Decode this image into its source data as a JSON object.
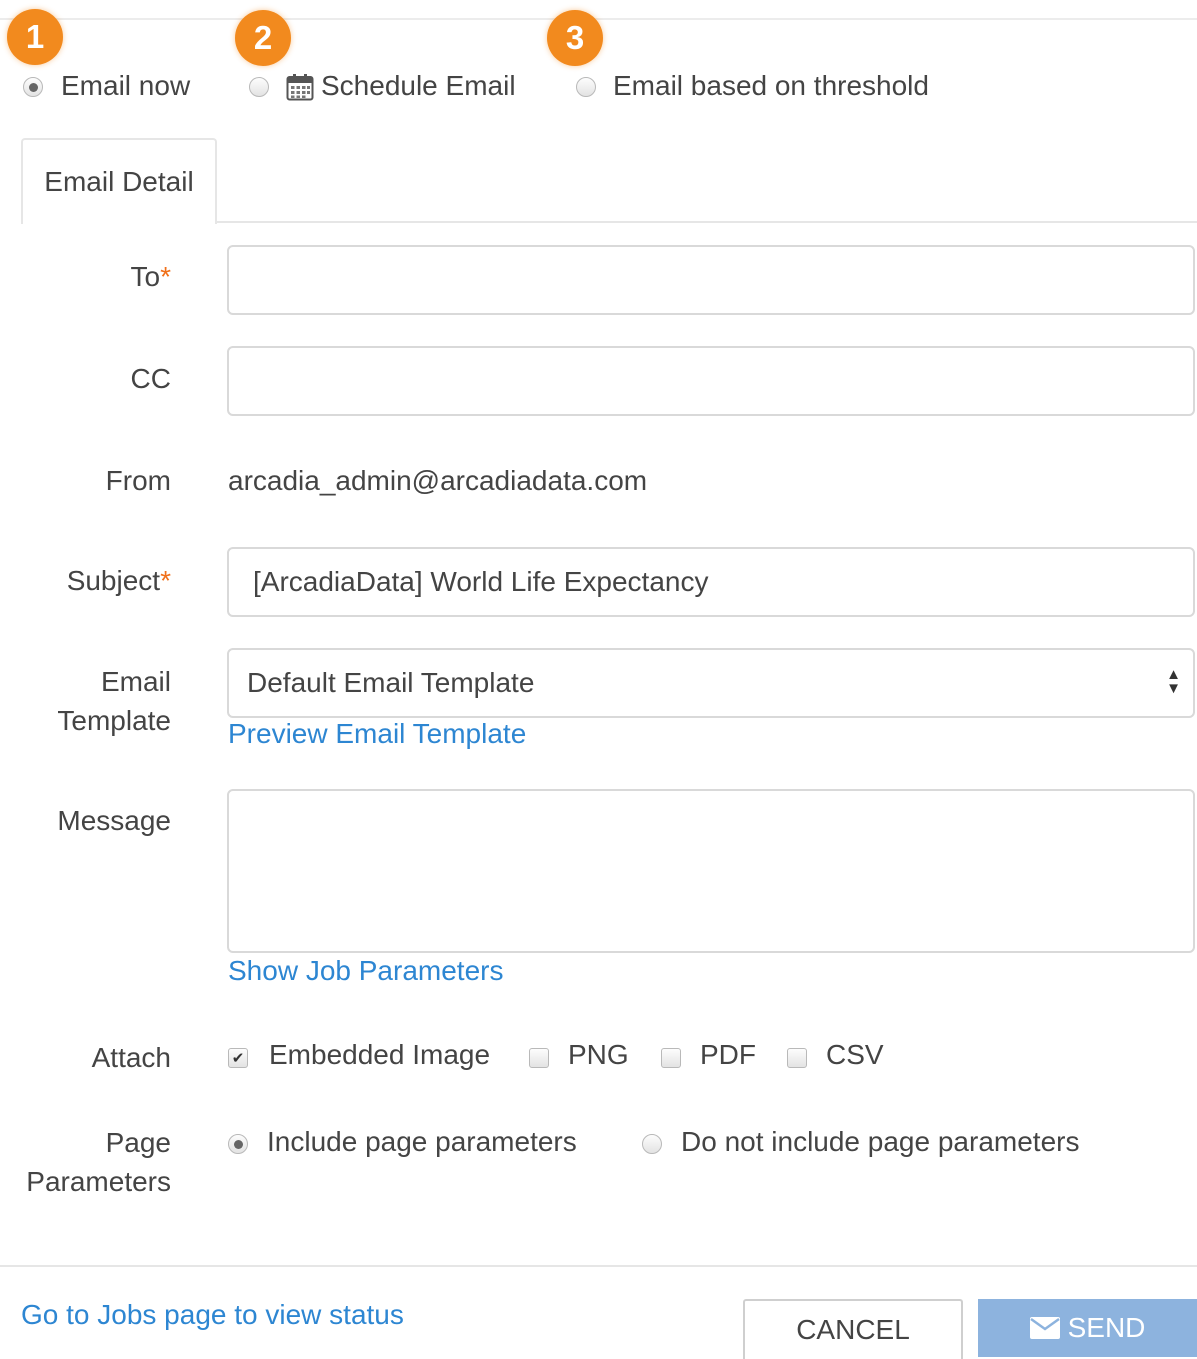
{
  "steps": [
    "1",
    "2",
    "3"
  ],
  "mode_options": {
    "email_now": "Email now",
    "schedule_email": "Schedule Email",
    "threshold": "Email based on threshold"
  },
  "selected_mode": "email_now",
  "tab": {
    "label": "Email Detail"
  },
  "form": {
    "to_label": "To",
    "cc_label": "CC",
    "from_label": "From",
    "from_value": "arcadia_admin@arcadiadata.com",
    "subject_label": "Subject",
    "subject_value": "[ArcadiaData] World Life Expectancy",
    "required_mark": "*",
    "template_label_line1": "Email",
    "template_label_line2": "Template",
    "template_selected": "Default Email Template",
    "preview_link": "Preview Email Template",
    "message_label": "Message",
    "job_params_link": "Show Job Parameters",
    "attach_label": "Attach",
    "attach_options": [
      {
        "label": "Embedded Image",
        "checked": true
      },
      {
        "label": "PNG",
        "checked": false
      },
      {
        "label": "PDF",
        "checked": false
      },
      {
        "label": "CSV",
        "checked": false
      }
    ],
    "page_params_label_line1": "Page",
    "page_params_label_line2": "Parameters",
    "page_param_options": {
      "include": "Include page parameters",
      "exclude": "Do not include page parameters"
    },
    "page_param_selected": "include"
  },
  "footer": {
    "jobs_link": "Go to Jobs page to view status",
    "cancel_label": "CANCEL",
    "send_label": "SEND"
  },
  "colors": {
    "badge": "#f28a1e",
    "link": "#2d86d2",
    "send_button": "#8db3de",
    "required": "#f0701a"
  },
  "icons": {
    "schedule": "calendar-icon",
    "send": "envelope-icon"
  }
}
